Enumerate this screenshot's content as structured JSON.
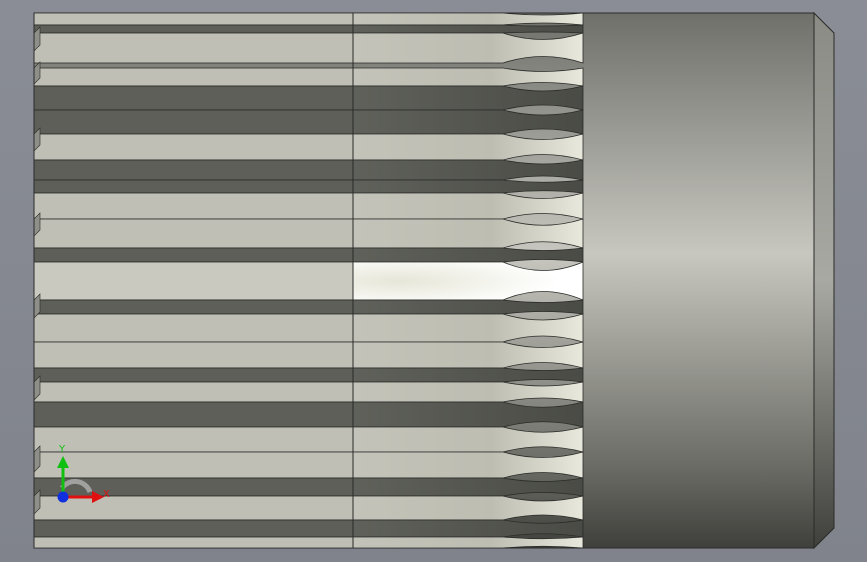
{
  "viewport": {
    "background": "#858891",
    "model_name": "spline-shaft"
  },
  "triad": {
    "x_label": "X",
    "y_label": "Y",
    "x_color": "#e01010",
    "y_color": "#10c010",
    "z_color": "#1030e0"
  },
  "colors": {
    "body_light": "#c6c6be",
    "body_dark": "#5d5f58",
    "highlight": "#ffffff",
    "edge": "#2a2b28"
  }
}
